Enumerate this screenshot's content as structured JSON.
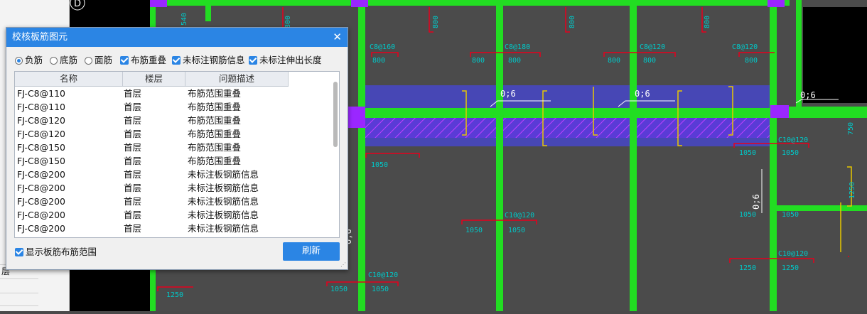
{
  "left_panel": {
    "row_label": "层"
  },
  "canvas": {
    "axis_label": "D",
    "rebar_labels": [
      "C8@160",
      "C8@180",
      "C8@120",
      "C8@120",
      "C10@120",
      "C10@120",
      "C10@120",
      "C10@120"
    ],
    "dim_values": [
      "800",
      "800",
      "800",
      "800",
      "800",
      "800",
      "800",
      "1050",
      "1050",
      "1050",
      "1050",
      "1050",
      "1050",
      "1050",
      "1250",
      "1250",
      "1250",
      "800",
      "800",
      "800",
      "1050",
      "1050",
      "1250",
      "540",
      "750"
    ],
    "markers": [
      "0;6",
      "0;6",
      "0;6",
      "0;6",
      "0;6"
    ]
  },
  "dialog": {
    "title": "校核板筋图元",
    "close_icon_glyph": "✕",
    "options": [
      {
        "type": "radio",
        "label": "负筋",
        "checked": true
      },
      {
        "type": "radio",
        "label": "底筋",
        "checked": false
      },
      {
        "type": "radio",
        "label": "面筋",
        "checked": false
      },
      {
        "type": "checkbox",
        "label": "布筋重叠",
        "checked": true
      },
      {
        "type": "checkbox",
        "label": "未标注钢筋信息",
        "checked": true
      },
      {
        "type": "checkbox",
        "label": "未标注伸出长度",
        "checked": true
      }
    ],
    "columns": [
      "名称",
      "楼层",
      "问题描述"
    ],
    "rows": [
      [
        "FJ-C8@110",
        "首层",
        "布筋范围重叠"
      ],
      [
        "FJ-C8@110",
        "首层",
        "布筋范围重叠"
      ],
      [
        "FJ-C8@120",
        "首层",
        "布筋范围重叠"
      ],
      [
        "FJ-C8@120",
        "首层",
        "布筋范围重叠"
      ],
      [
        "FJ-C8@150",
        "首层",
        "布筋范围重叠"
      ],
      [
        "FJ-C8@150",
        "首层",
        "布筋范围重叠"
      ],
      [
        "FJ-C8@200",
        "首层",
        "未标注板钢筋信息"
      ],
      [
        "FJ-C8@200",
        "首层",
        "未标注板钢筋信息"
      ],
      [
        "FJ-C8@200",
        "首层",
        "未标注板钢筋信息"
      ],
      [
        "FJ-C8@200",
        "首层",
        "未标注板钢筋信息"
      ],
      [
        "FJ-C8@200",
        "首层",
        "未标注板钢筋信息"
      ]
    ],
    "show_range_label": "显示板筋布筋范围",
    "show_range_checked": true,
    "refresh_label": "刷新"
  },
  "colors": {
    "accent": "#2b85e4",
    "beam": "#22dd22",
    "rebar": "#e8001c",
    "text_cyan": "#00c8c8",
    "highlight": "#5050e0",
    "column": "#9a27ff"
  }
}
